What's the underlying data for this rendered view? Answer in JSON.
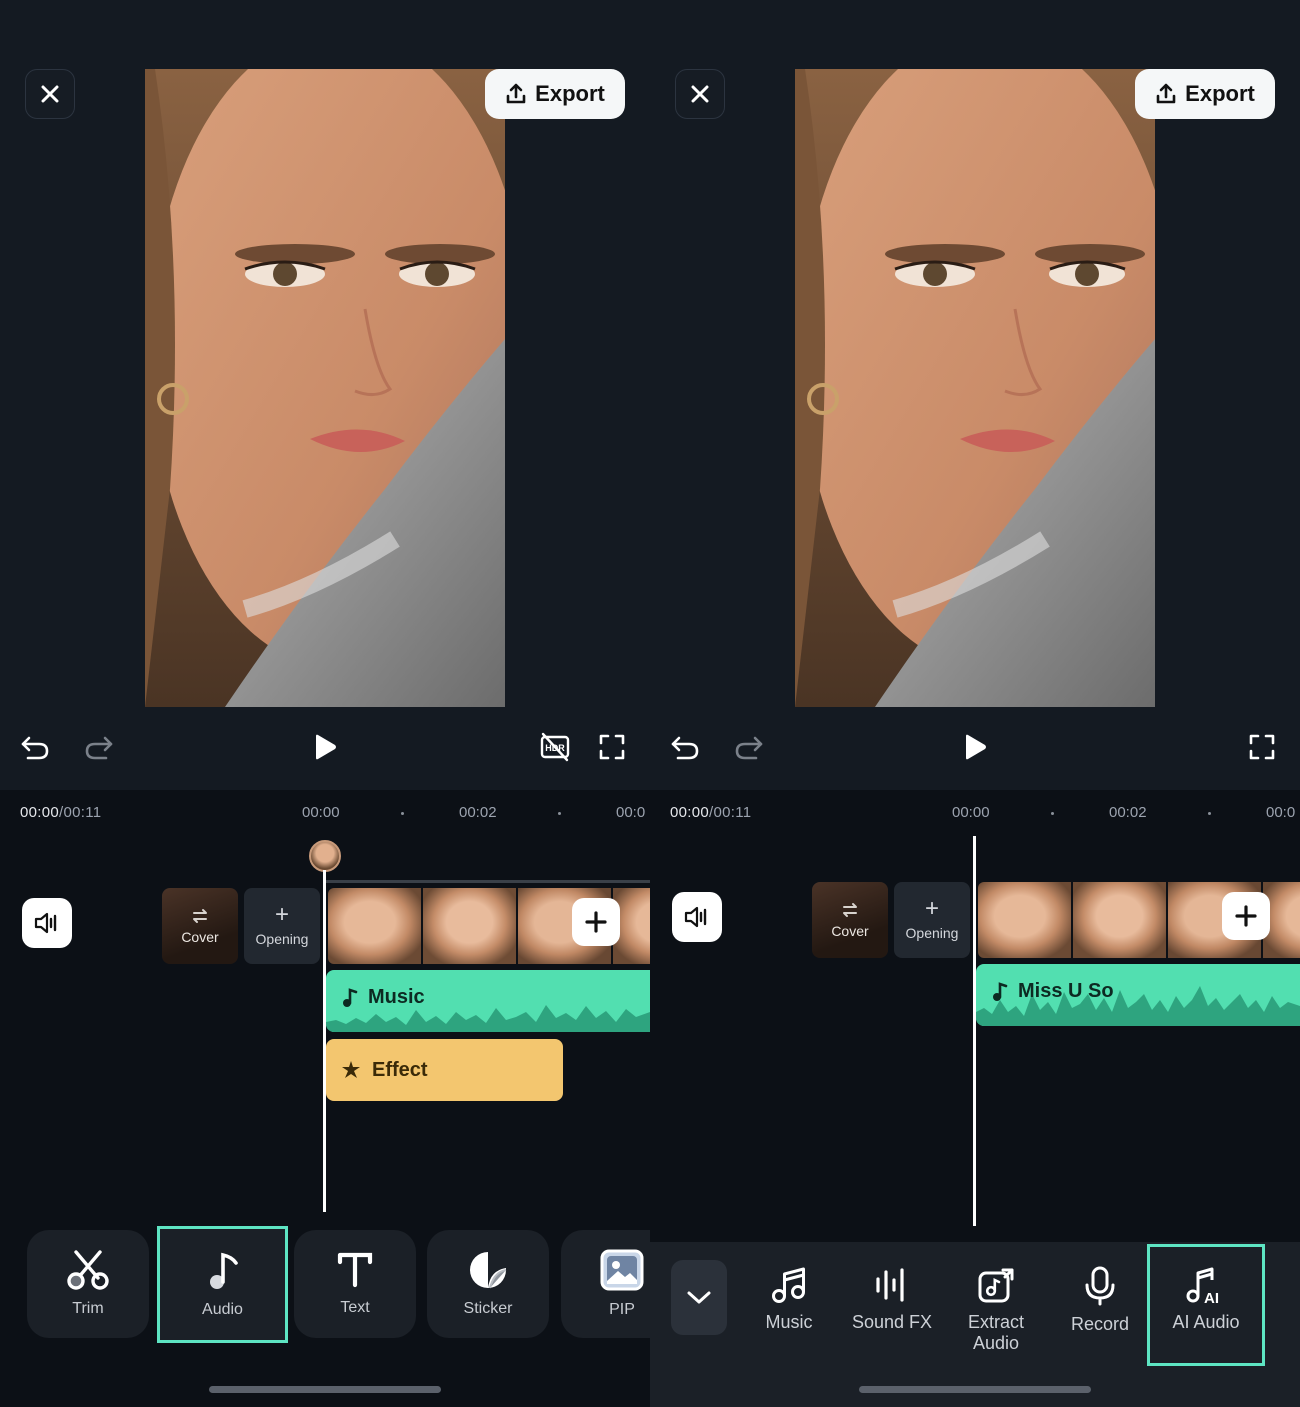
{
  "left_screen": {
    "export_label": "Export",
    "timecode_current": "00:00",
    "timecode_total": "/00:11",
    "ruler_ticks": [
      "00:00",
      "00:02",
      "00:0"
    ],
    "cover_label": "Cover",
    "opening_label": "Opening",
    "music_track_label": "Music",
    "effect_track_label": "Effect",
    "tools": [
      {
        "label": "Trim",
        "icon": "scissors-icon",
        "selected": false
      },
      {
        "label": "Audio",
        "icon": "music-note-icon",
        "selected": true
      },
      {
        "label": "Text",
        "icon": "text-icon",
        "selected": false
      },
      {
        "label": "Sticker",
        "icon": "sticker-icon",
        "selected": false
      },
      {
        "label": "PIP",
        "icon": "pip-image-icon",
        "selected": false
      }
    ]
  },
  "right_screen": {
    "export_label": "Export",
    "timecode_current": "00:00",
    "timecode_total": "/00:11",
    "ruler_ticks": [
      "00:00",
      "00:02",
      "00:0"
    ],
    "cover_label": "Cover",
    "opening_label": "Opening",
    "music_track_label": "Miss U So",
    "audio_tools": [
      {
        "label": "Music",
        "icon": "music-notes-icon",
        "selected": false
      },
      {
        "label": "Sound FX",
        "icon": "sound-fx-bars-icon",
        "selected": false
      },
      {
        "label": "Extract\nAudio",
        "label_line1": "Extract",
        "label_line2": "Audio",
        "icon": "extract-audio-icon",
        "selected": false
      },
      {
        "label": "Record",
        "icon": "microphone-icon",
        "selected": false
      },
      {
        "label": "AI Audio",
        "icon": "ai-audio-icon",
        "selected": true
      }
    ]
  },
  "colors": {
    "accent_teal": "#5ee5c3",
    "music_track": "#52dfb0",
    "effect_track": "#f3c66f",
    "background": "#0c1016"
  }
}
